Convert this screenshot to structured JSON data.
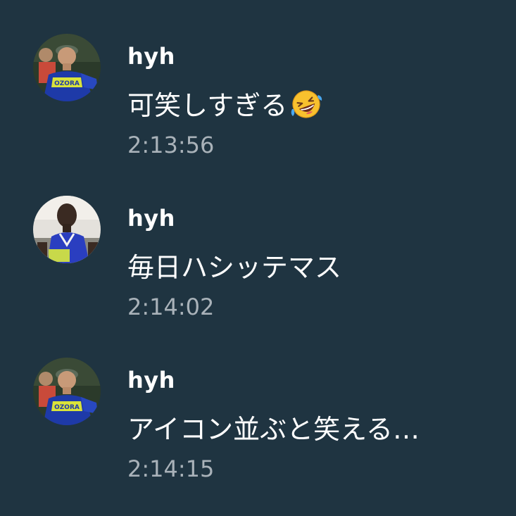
{
  "colors": {
    "background": "#1f3441",
    "username": "#ffffff",
    "message": "#ffffff",
    "timestamp": "#a9b2b9"
  },
  "messages": [
    {
      "user": "hyh",
      "avatar": "runner-blue-jersey-cap",
      "text": "可笑しすぎる",
      "emoji": "rolling-on-the-floor-laughing",
      "time": "2:13:56"
    },
    {
      "user": "hyh",
      "avatar": "runner-blue-singlet",
      "text": "毎日ハシッテマス",
      "time": "2:14:02"
    },
    {
      "user": "hyh",
      "avatar": "runner-blue-jersey-cap",
      "text": "アイコン並ぶと笑える…",
      "time": "2:14:15"
    }
  ]
}
